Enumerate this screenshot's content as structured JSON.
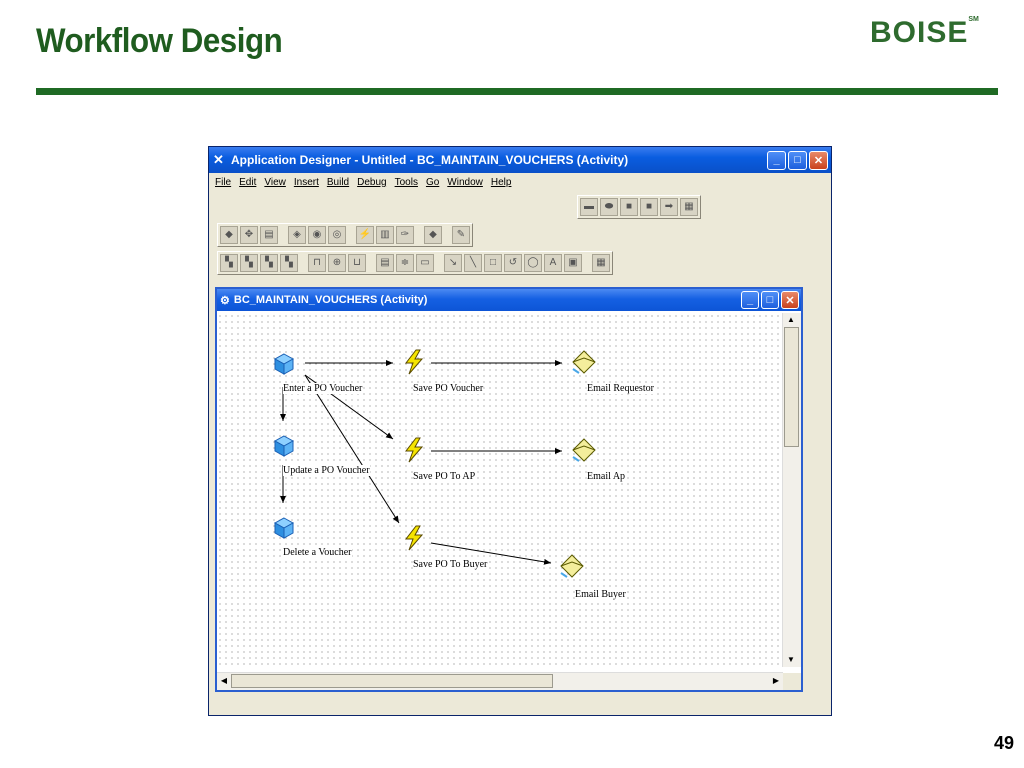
{
  "slide": {
    "title": "Workflow Design",
    "logo": "BOISE",
    "logo_mark": "SM",
    "page_number": "49"
  },
  "app": {
    "title": "Application Designer - Untitled - BC_MAINTAIN_VOUCHERS (Activity)",
    "menu": [
      "File",
      "Edit",
      "View",
      "Insert",
      "Build",
      "Debug",
      "Tools",
      "Go",
      "Window",
      "Help"
    ]
  },
  "inner": {
    "title": "BC_MAINTAIN_VOUCHERS (Activity)",
    "nodes": {
      "enter_po_voucher": "Enter a PO Voucher",
      "update_po_voucher": "Update a PO Voucher",
      "delete_voucher": "Delete a Voucher",
      "save_po_voucher": "Save PO Voucher",
      "save_po_to_ap": "Save PO To AP",
      "save_po_to_buyer": "Save PO To Buyer",
      "email_requestor": "Email Requestor",
      "email_ap": "Email Ap",
      "email_buyer": "Email Buyer"
    }
  },
  "colors": {
    "title_green": "#1f5c1f",
    "rule_green": "#1f6a24",
    "titlebar_blue": "#0a5de0"
  }
}
